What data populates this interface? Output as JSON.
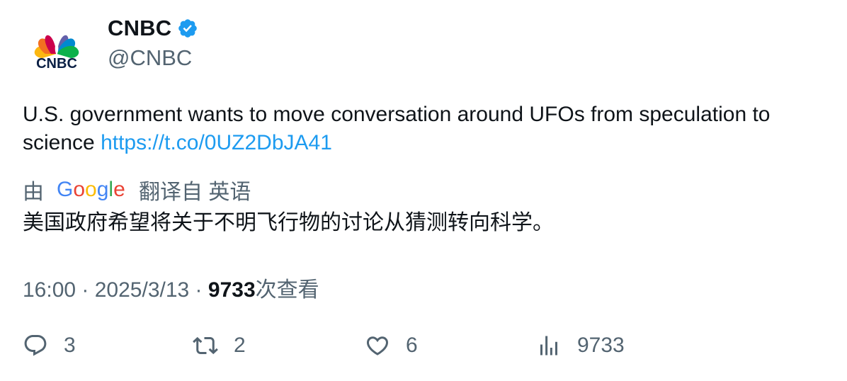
{
  "author": {
    "display_name": "CNBC",
    "handle": "@CNBC",
    "logo_text": "CNBC",
    "verified": true
  },
  "tweet": {
    "text": "U.S. government wants to move conversation around UFOs from speculation to science ",
    "link": "https://t.co/0UZ2DbJA41"
  },
  "translation": {
    "prefix": "由",
    "provider": "Google",
    "suffix": "翻译自 英语",
    "text": "美国政府希望将关于不明飞行物的讨论从猜测转向科学。"
  },
  "meta": {
    "time": "16:00",
    "separator": " · ",
    "date": "2025/3/13",
    "views": "9733",
    "views_label": "次查看"
  },
  "actions": {
    "replies": "3",
    "retweets": "2",
    "likes": "6",
    "views": "9733"
  },
  "colors": {
    "link": "#1d9bf0",
    "secondary_text": "#536471",
    "verified": "#1d9bf0"
  },
  "icons": [
    "cnbc-peacock-logo",
    "verified-badge-icon",
    "google-logo",
    "reply-icon",
    "retweet-icon",
    "like-icon",
    "views-icon"
  ]
}
